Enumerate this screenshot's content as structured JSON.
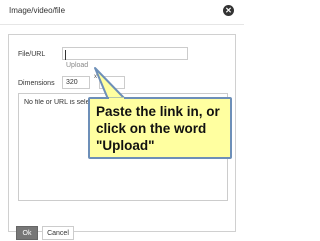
{
  "dialog": {
    "title": "Image/video/file",
    "close_icon": "close-icon"
  },
  "form": {
    "file_url_label": "File/URL",
    "file_url_value": "",
    "upload_link": "Upload",
    "dimensions_label": "Dimensions",
    "width_value": "320",
    "height_value": "2",
    "dimension_separator": "x"
  },
  "preview": {
    "text": "No file or URL is selected"
  },
  "buttons": {
    "ok": "Ok",
    "cancel": "Cancel"
  },
  "callout": {
    "text": "Paste the link in, or click on the word \"Upload\""
  },
  "colors": {
    "callout_bg": "#ffffa0",
    "callout_border": "#6d8fb8"
  }
}
